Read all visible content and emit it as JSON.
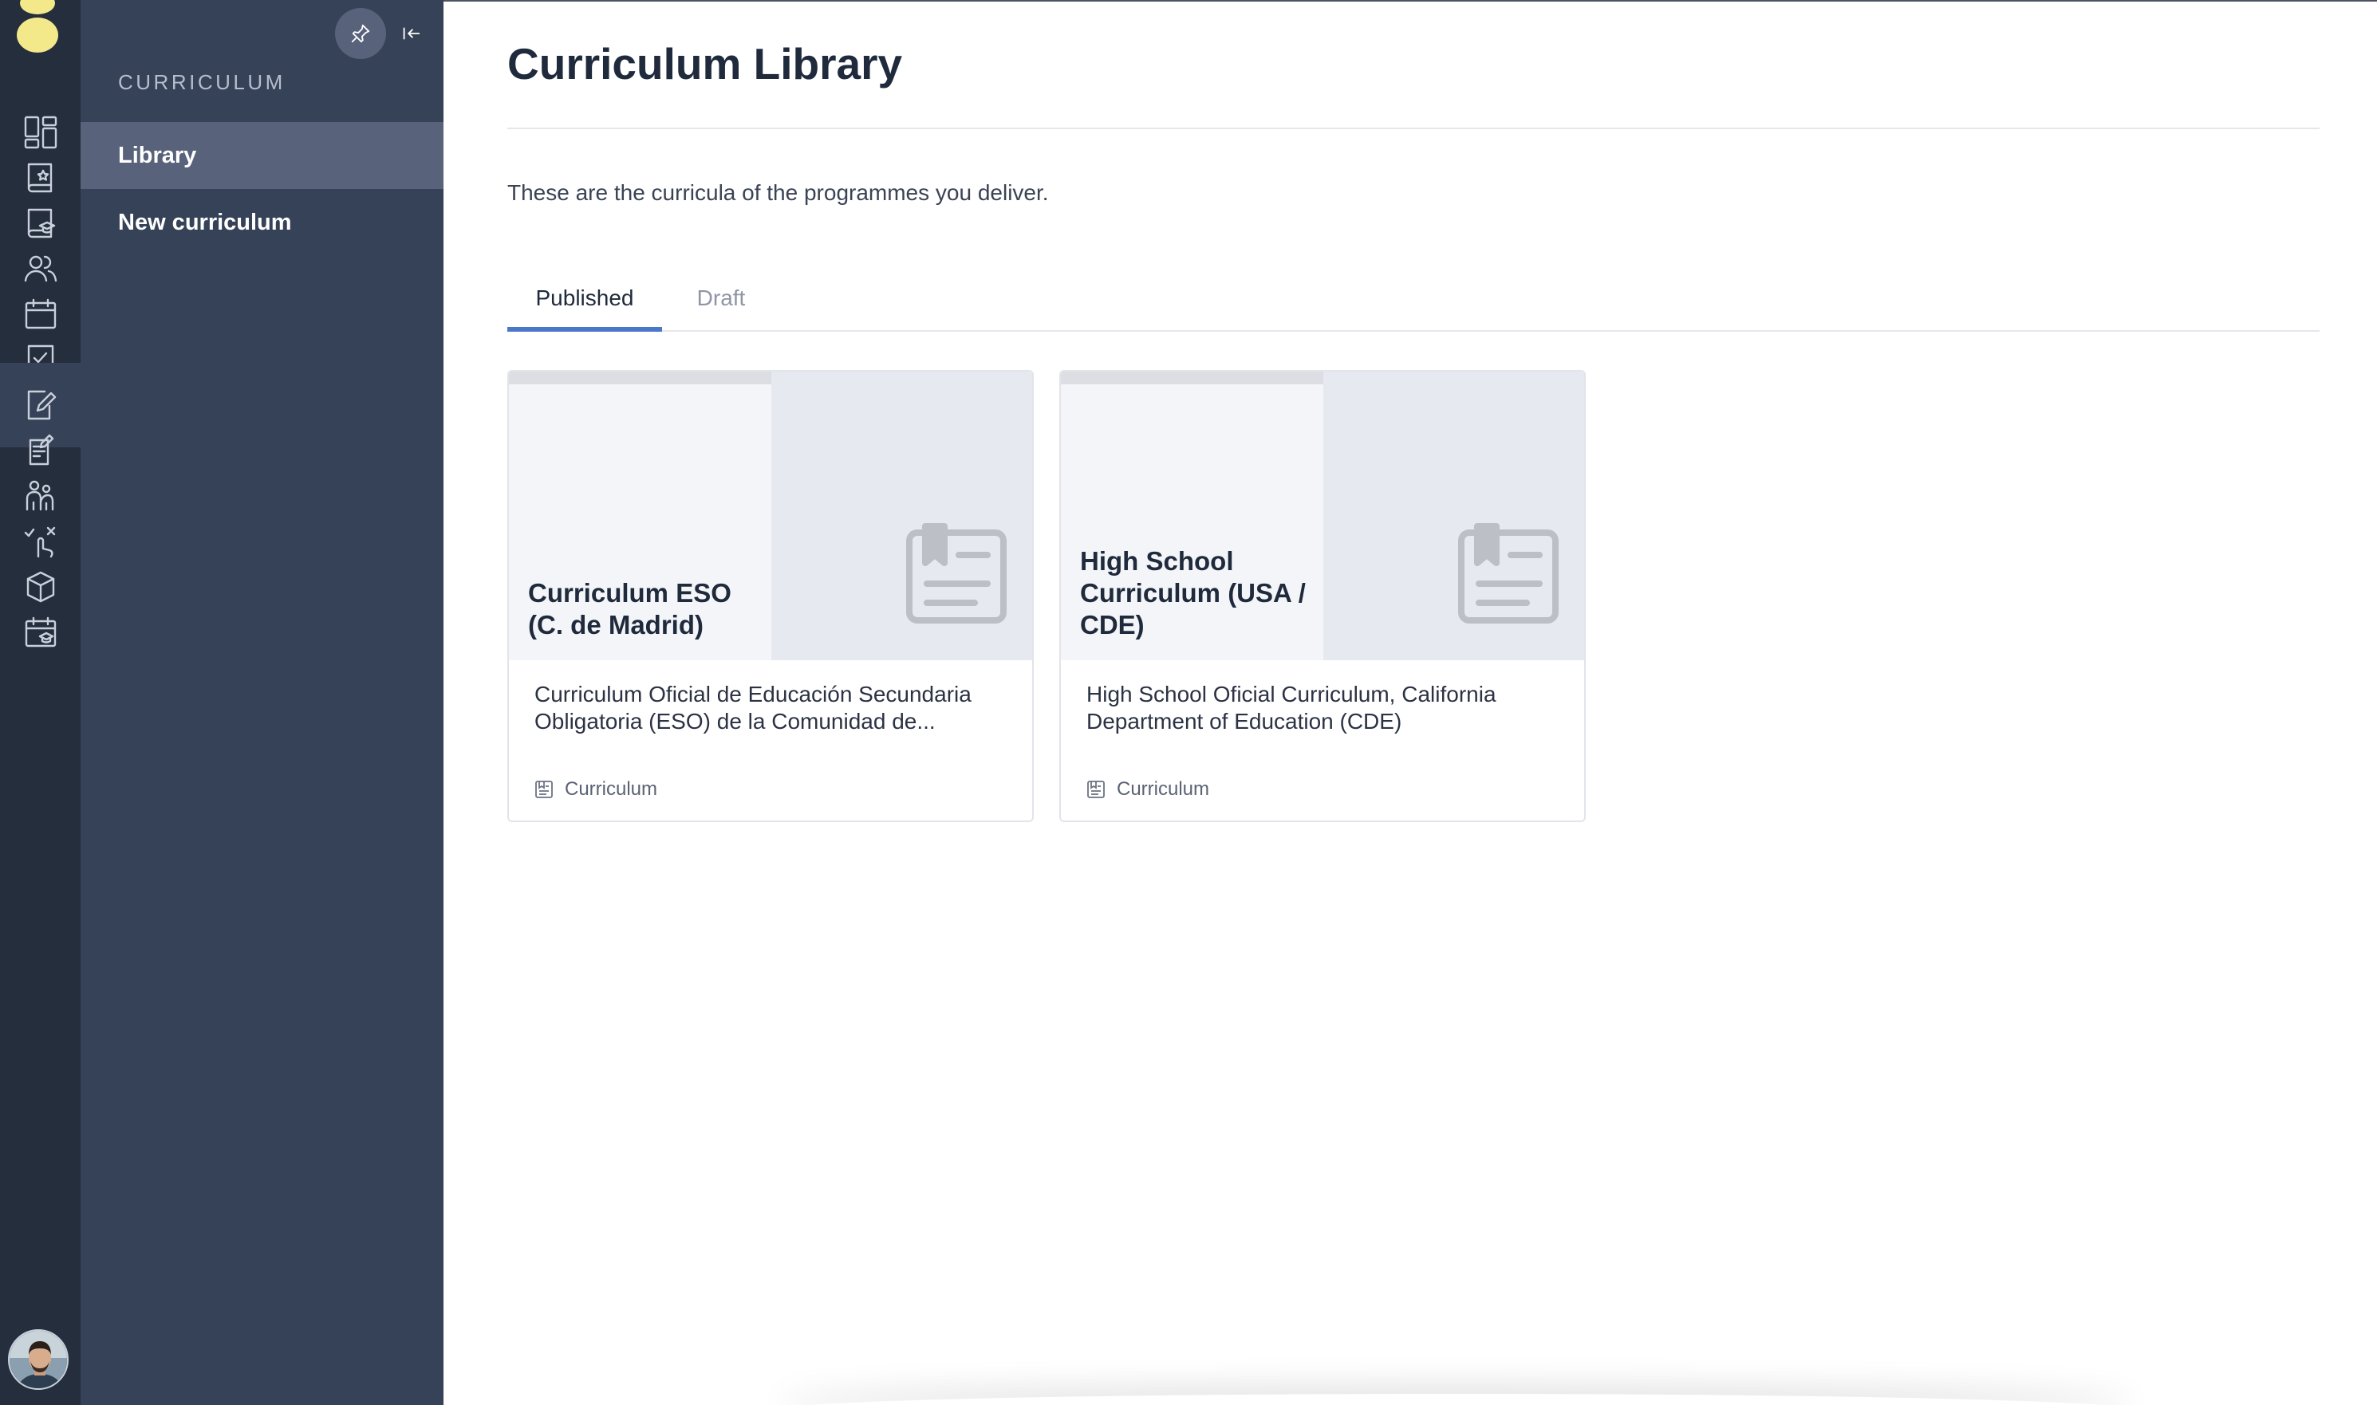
{
  "colors": {
    "rail_bg": "#252e3d",
    "panel_bg": "#364257",
    "active_item_bg": "#58627a",
    "accent": "#4b77c8",
    "logo": "#f3e88a"
  },
  "rail": {
    "items": [
      {
        "icon": "dashboard-icon"
      },
      {
        "icon": "book-star-icon"
      },
      {
        "icon": "book-graduation-icon"
      },
      {
        "icon": "users-icon"
      },
      {
        "icon": "calendar-icon"
      },
      {
        "icon": "task-check-icon"
      },
      {
        "icon": "curriculum-edit-icon",
        "active": true
      },
      {
        "icon": "document-sign-icon"
      },
      {
        "icon": "people-hands-icon"
      },
      {
        "icon": "tap-gesture-icon"
      },
      {
        "icon": "cube-icon"
      },
      {
        "icon": "calendar-graduation-icon"
      }
    ]
  },
  "sidebar": {
    "heading": "CURRICULUM",
    "items": [
      {
        "label": "Library",
        "active": true
      },
      {
        "label": "New curriculum",
        "active": false
      }
    ]
  },
  "main": {
    "title": "Curriculum Library",
    "intro": "These are the curricula of the programmes you deliver.",
    "tabs": [
      {
        "label": "Published",
        "active": true
      },
      {
        "label": "Draft",
        "active": false
      }
    ],
    "cards": [
      {
        "title": "Curriculum ESO (C. de Madrid)",
        "description": "Curriculum Oficial de Educación Secundaria Obligatoria (ESO) de la Comunidad de...",
        "type": "Curriculum"
      },
      {
        "title": "High School Curriculum (USA / CDE)",
        "description": "High School Oficial Curriculum, California Department of Education (CDE)",
        "type": "Curriculum"
      }
    ]
  }
}
